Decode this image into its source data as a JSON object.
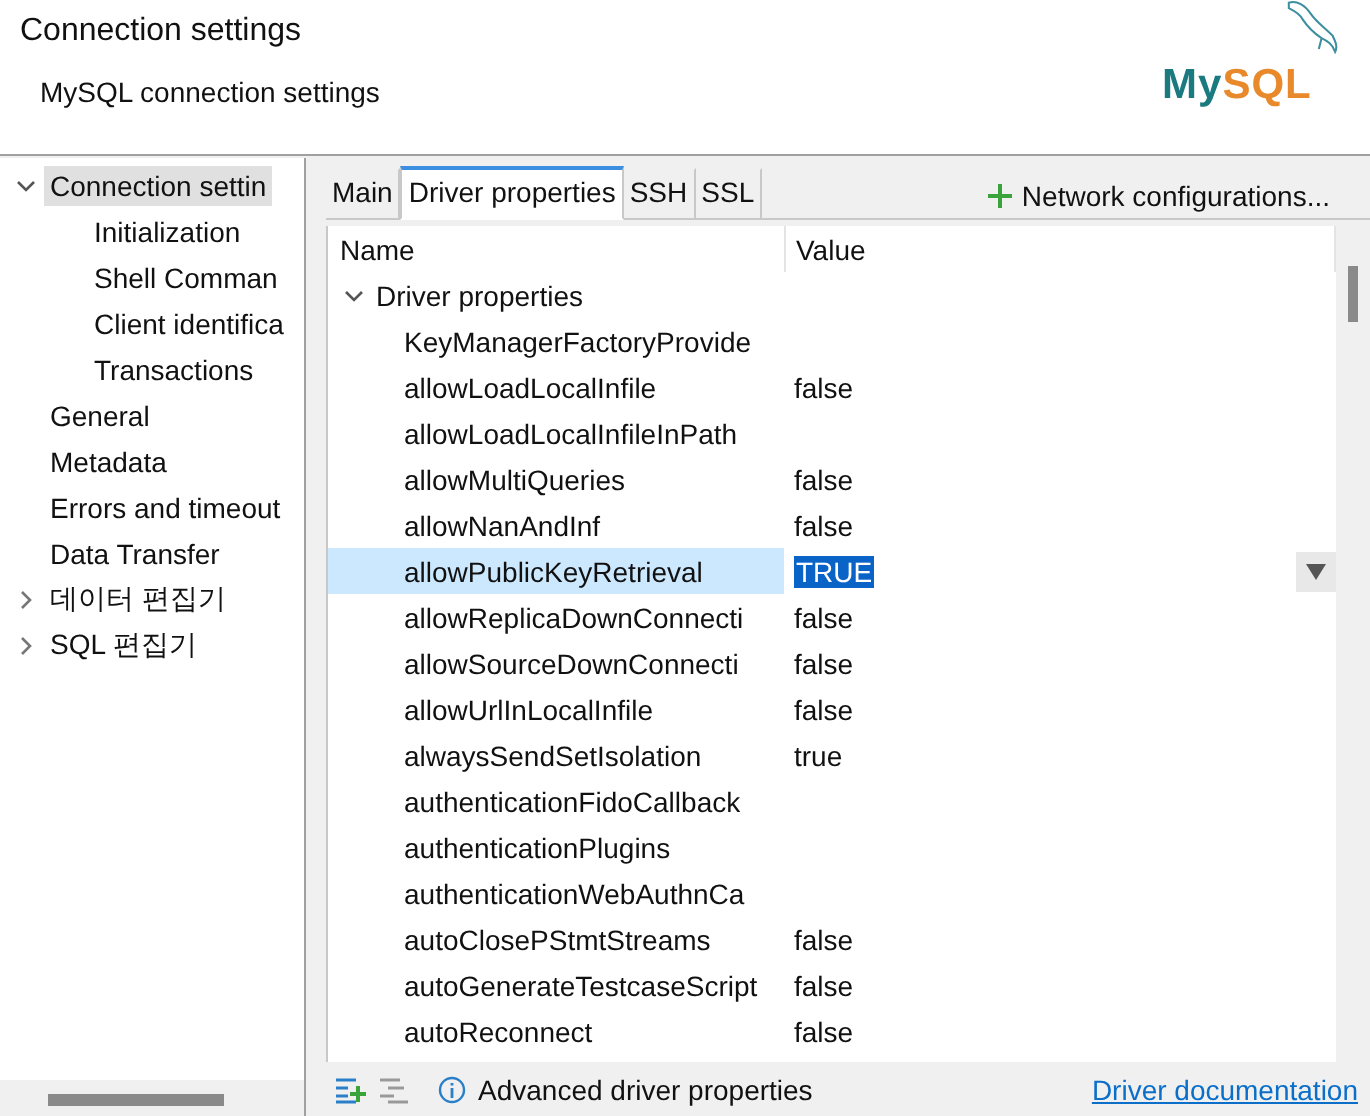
{
  "header": {
    "title": "Connection settings",
    "subtitle": "MySQL connection settings",
    "logo": {
      "text_1": "My",
      "text_2": "SQL"
    }
  },
  "sidebar": {
    "items": [
      {
        "label": "Connection settin",
        "selected": true,
        "expanded": true,
        "children": [
          {
            "label": "Initialization",
            "selected": false
          },
          {
            "label": "Shell Comman",
            "selected": false
          },
          {
            "label": "Client identifica",
            "selected": false
          },
          {
            "label": "Transactions",
            "selected": false
          }
        ]
      },
      {
        "label": "General",
        "selected": false
      },
      {
        "label": "Metadata",
        "selected": false
      },
      {
        "label": "Errors and timeout",
        "selected": false
      },
      {
        "label": "Data Transfer",
        "selected": false
      },
      {
        "label": "데이터 편집기",
        "selected": false,
        "expanded": false
      },
      {
        "label": "SQL 편집기",
        "selected": false,
        "expanded": false
      }
    ]
  },
  "tabs": [
    {
      "label": "Main",
      "selected": false
    },
    {
      "label": "Driver properties",
      "selected": true
    },
    {
      "label": "SSH",
      "selected": false
    },
    {
      "label": "SSL",
      "selected": false
    }
  ],
  "network_button": "Network configurations...",
  "table": {
    "columns": [
      "Name",
      "Value"
    ],
    "group": {
      "label": "Driver properties",
      "expanded": true
    },
    "rows": [
      {
        "name": "KeyManagerFactoryProvide",
        "selected": false
      },
      {
        "name": "allowLoadLocalInfile",
        "value": "false",
        "selected": false
      },
      {
        "name": "allowLoadLocalInfileInPath",
        "selected": false
      },
      {
        "name": "allowMultiQueries",
        "value": "false",
        "selected": false
      },
      {
        "name": "allowNanAndInf",
        "value": "false",
        "selected": false
      },
      {
        "name": "allowPublicKeyRetrieval",
        "value": "TRUE",
        "selected": true
      },
      {
        "name": "allowReplicaDownConnecti",
        "value": "false",
        "selected": false
      },
      {
        "name": "allowSourceDownConnecti",
        "value": "false",
        "selected": false
      },
      {
        "name": "allowUrlInLocalInfile",
        "value": "false",
        "selected": false
      },
      {
        "name": "alwaysSendSetIsolation",
        "value": "true",
        "selected": false
      },
      {
        "name": "authenticationFidoCallback",
        "selected": false
      },
      {
        "name": "authenticationPlugins",
        "selected": false
      },
      {
        "name": "authenticationWebAuthnCa",
        "selected": false
      },
      {
        "name": "autoClosePStmtStreams",
        "value": "false",
        "selected": false
      },
      {
        "name": "autoGenerateTestcaseScript",
        "value": "false",
        "selected": false
      },
      {
        "name": "autoReconnect",
        "value": "false",
        "selected": false
      }
    ]
  },
  "footer": {
    "info": "Advanced driver properties",
    "link": "Driver documentation"
  }
}
